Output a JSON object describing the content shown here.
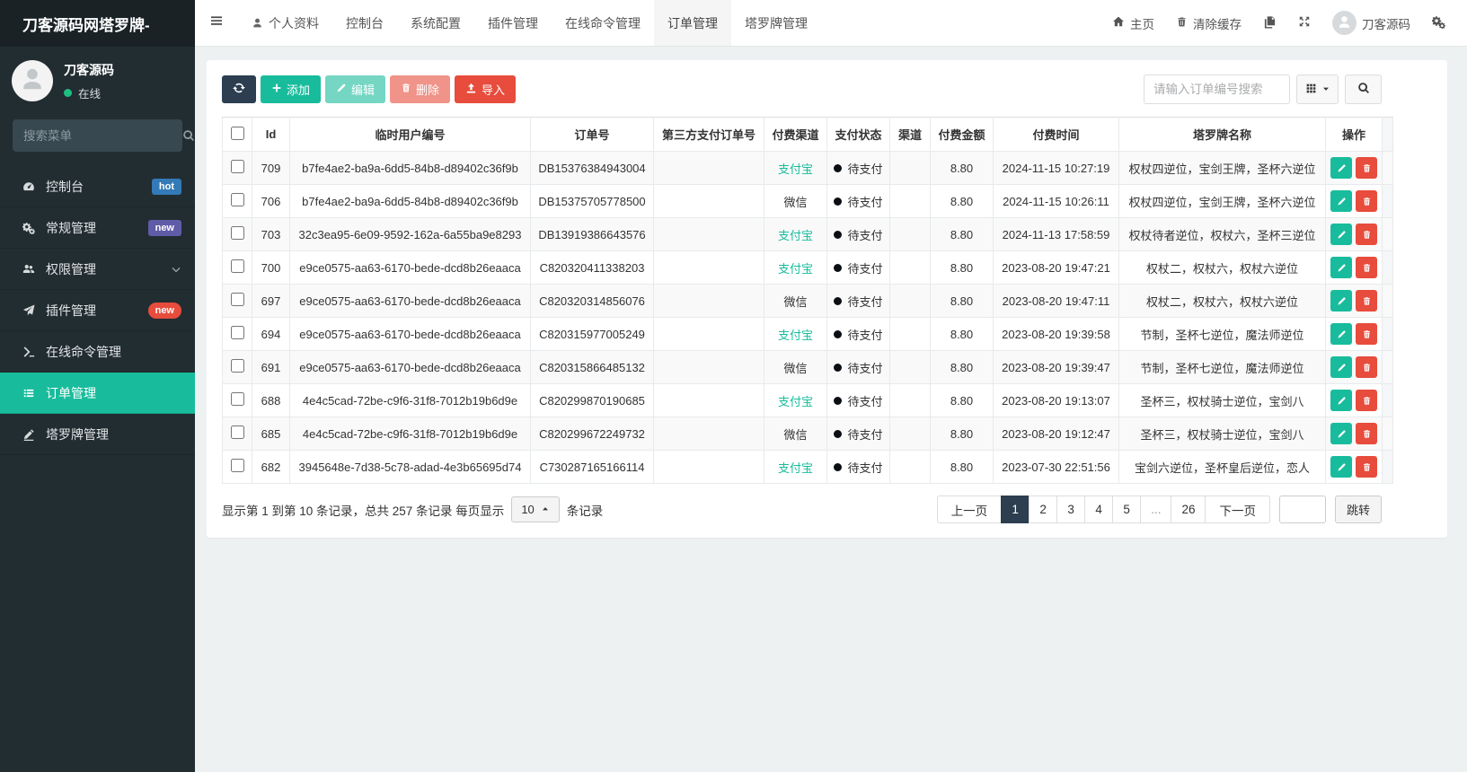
{
  "brand": {
    "title": "刀客源码网塔罗牌-"
  },
  "navbar": {
    "items": [
      {
        "label": "个人资料",
        "icon": "person"
      },
      {
        "label": "控制台"
      },
      {
        "label": "系统配置"
      },
      {
        "label": "插件管理"
      },
      {
        "label": "在线命令管理"
      },
      {
        "label": "订单管理",
        "active": true
      },
      {
        "label": "塔罗牌管理"
      }
    ],
    "right": {
      "home": "主页",
      "clear_cache": "清除缓存",
      "username": "刀客源码"
    }
  },
  "sidebar": {
    "user": {
      "name": "刀客源码",
      "status": "在线"
    },
    "search_placeholder": "搜索菜单",
    "items": [
      {
        "label": "控制台",
        "icon": "dashboard",
        "badge": "hot",
        "badge_color": "#337ab7"
      },
      {
        "label": "常规管理",
        "icon": "gears",
        "badge": "new",
        "badge_color": "#605ca8"
      },
      {
        "label": "权限管理",
        "icon": "users",
        "chevron": true
      },
      {
        "label": "插件管理",
        "icon": "plane",
        "badge": "new",
        "badge_color": "#e74c3c",
        "badge_pill": true
      },
      {
        "label": "在线命令管理",
        "icon": "terminal"
      },
      {
        "label": "订单管理",
        "icon": "list",
        "active": true
      },
      {
        "label": "塔罗牌管理",
        "icon": "pen"
      }
    ]
  },
  "toolbar": {
    "add": "添加",
    "edit": "编辑",
    "delete": "删除",
    "import": "导入",
    "search_placeholder": "请输入订单编号搜索"
  },
  "table": {
    "columns": [
      "Id",
      "临时用户编号",
      "订单号",
      "第三方支付订单号",
      "付费渠道",
      "支付状态",
      "渠道",
      "付费金额",
      "付费时间",
      "塔罗牌名称",
      "操作"
    ],
    "alipay_color": "#18bc9c",
    "rows": [
      {
        "id": "709",
        "user": "b7fe4ae2-ba9a-6dd5-84b8-d89402c36f9b",
        "order": "DB15376384943004",
        "third": "",
        "channel": "支付宝",
        "status": "待支付",
        "qudao": "",
        "amount": "8.80",
        "time": "2024-11-15 10:27:19",
        "tarot": "权杖四逆位，宝剑王牌，圣杯六逆位"
      },
      {
        "id": "706",
        "user": "b7fe4ae2-ba9a-6dd5-84b8-d89402c36f9b",
        "order": "DB15375705778500",
        "third": "",
        "channel": "微信",
        "status": "待支付",
        "qudao": "",
        "amount": "8.80",
        "time": "2024-11-15 10:26:11",
        "tarot": "权杖四逆位，宝剑王牌，圣杯六逆位"
      },
      {
        "id": "703",
        "user": "32c3ea95-6e09-9592-162a-6a55ba9e8293",
        "order": "DB13919386643576",
        "third": "",
        "channel": "支付宝",
        "status": "待支付",
        "qudao": "",
        "amount": "8.80",
        "time": "2024-11-13 17:58:59",
        "tarot": "权杖待者逆位，权杖六，圣杯三逆位"
      },
      {
        "id": "700",
        "user": "e9ce0575-aa63-6170-bede-dcd8b26eaaca",
        "order": "C820320411338203",
        "third": "",
        "channel": "支付宝",
        "status": "待支付",
        "qudao": "",
        "amount": "8.80",
        "time": "2023-08-20 19:47:21",
        "tarot": "权杖二，权杖六，权杖六逆位"
      },
      {
        "id": "697",
        "user": "e9ce0575-aa63-6170-bede-dcd8b26eaaca",
        "order": "C820320314856076",
        "third": "",
        "channel": "微信",
        "status": "待支付",
        "qudao": "",
        "amount": "8.80",
        "time": "2023-08-20 19:47:11",
        "tarot": "权杖二，权杖六，权杖六逆位"
      },
      {
        "id": "694",
        "user": "e9ce0575-aa63-6170-bede-dcd8b26eaaca",
        "order": "C820315977005249",
        "third": "",
        "channel": "支付宝",
        "status": "待支付",
        "qudao": "",
        "amount": "8.80",
        "time": "2023-08-20 19:39:58",
        "tarot": "节制，圣杯七逆位，魔法师逆位"
      },
      {
        "id": "691",
        "user": "e9ce0575-aa63-6170-bede-dcd8b26eaaca",
        "order": "C820315866485132",
        "third": "",
        "channel": "微信",
        "status": "待支付",
        "qudao": "",
        "amount": "8.80",
        "time": "2023-08-20 19:39:47",
        "tarot": "节制，圣杯七逆位，魔法师逆位"
      },
      {
        "id": "688",
        "user": "4e4c5cad-72be-c9f6-31f8-7012b19b6d9e",
        "order": "C820299870190685",
        "third": "",
        "channel": "支付宝",
        "status": "待支付",
        "qudao": "",
        "amount": "8.80",
        "time": "2023-08-20 19:13:07",
        "tarot": "圣杯三，权杖骑士逆位，宝剑八"
      },
      {
        "id": "685",
        "user": "4e4c5cad-72be-c9f6-31f8-7012b19b6d9e",
        "order": "C820299672249732",
        "third": "",
        "channel": "微信",
        "status": "待支付",
        "qudao": "",
        "amount": "8.80",
        "time": "2023-08-20 19:12:47",
        "tarot": "圣杯三，权杖骑士逆位，宝剑八"
      },
      {
        "id": "682",
        "user": "3945648e-7d38-5c78-adad-4e3b65695d74",
        "order": "C730287165166114",
        "third": "",
        "channel": "支付宝",
        "status": "待支付",
        "qudao": "",
        "amount": "8.80",
        "time": "2023-07-30 22:51:56",
        "tarot": "宝剑六逆位，圣杯皇后逆位，恋人"
      }
    ]
  },
  "pagination": {
    "summary_prefix": "显示第 1 到第 10 条记录，总共 257 条记录 每页显示",
    "page_size": "10",
    "summary_suffix": "条记录",
    "prev": "上一页",
    "next": "下一页",
    "pages": [
      "1",
      "2",
      "3",
      "4",
      "5",
      "...",
      "26"
    ],
    "active_page": "1",
    "jump_value": "",
    "jump": "跳转"
  },
  "colors": {
    "accent": "#18bc9c",
    "dark": "#2c3e50",
    "danger": "#e74c3c"
  }
}
